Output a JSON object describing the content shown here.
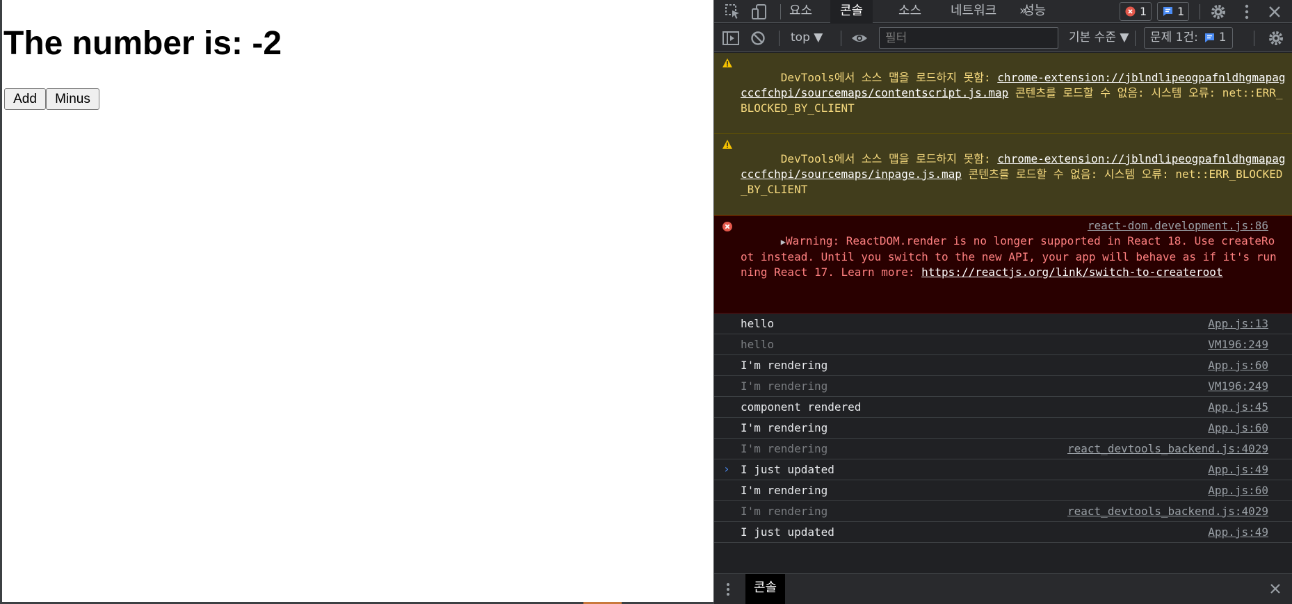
{
  "page": {
    "heading": "The number is: -2",
    "add_label": "Add",
    "minus_label": "Minus"
  },
  "devtools": {
    "tabs": [
      {
        "label": "요소",
        "active": false
      },
      {
        "label": "콘솔",
        "active": true
      },
      {
        "label": "소스",
        "active": false
      },
      {
        "label": "네트워크",
        "active": false
      },
      {
        "label": "성능",
        "active": false
      }
    ],
    "more_tabs": "»",
    "error_count": "1",
    "message_count": "1",
    "toolbar": {
      "context": "top ▼",
      "filter_placeholder": "필터",
      "levels": "기본 수준 ▼",
      "issues": "문제 1건:",
      "issues_count": "1"
    },
    "colors": {
      "warning_bg": "#413d1c",
      "error_bg": "#290000",
      "accent": "#4c8df6"
    },
    "messages": {
      "warning1": {
        "prefix": "DevTools에서 소스 맵을 로드하지 못함: ",
        "link": "chrome-extension://jblndlipeogpafnldhgmapagcccfchpi/sourcemaps/contentscript.js.map",
        "suffix": " 콘텐츠를 로드할 수 없음: 시스템 오류: net::ERR_BLOCKED_BY_CLIENT"
      },
      "warning2": {
        "prefix": "DevTools에서 소스 맵을 로드하지 못함: ",
        "link": "chrome-extension://jblndlipeogpafnldhgmapagcccfchpi/sourcemaps/inpage.js.map",
        "suffix": " 콘텐츠를 로드할 수 없음: 시스템 오류: net::ERR_BLOCKED_BY_CLIENT"
      },
      "error1": {
        "text": "Warning: ReactDOM.render is no longer supported in React 18. Use createRoot instead. Until you switch to the new API, your app will behave as if it's running React 17. Learn more: ",
        "link": "https://reactjs.org/link/switch-to-createroot",
        "source": "react-dom.development.js:86"
      },
      "logs": [
        {
          "text": "hello",
          "source": "App.js:13",
          "dim": false
        },
        {
          "text": "hello",
          "source": "VM196:249",
          "dim": true
        },
        {
          "text": "I'm rendering",
          "source": "App.js:60",
          "dim": false
        },
        {
          "text": "I'm rendering",
          "source": "VM196:249",
          "dim": true
        },
        {
          "text": "component rendered",
          "source": "App.js:45",
          "dim": false
        },
        {
          "text": "I'm rendering",
          "source": "App.js:60",
          "dim": false
        },
        {
          "text": "I'm rendering",
          "source": "react_devtools_backend.js:4029",
          "dim": true
        },
        {
          "text": "I just updated",
          "source": "App.js:49",
          "dim": false
        },
        {
          "text": "I'm rendering",
          "source": "App.js:60",
          "dim": false
        },
        {
          "text": "I'm rendering",
          "source": "react_devtools_backend.js:4029",
          "dim": true
        },
        {
          "text": "I just updated",
          "source": "App.js:49",
          "dim": false
        }
      ],
      "prompt": "›"
    },
    "drawer": {
      "tab": "콘솔"
    }
  }
}
